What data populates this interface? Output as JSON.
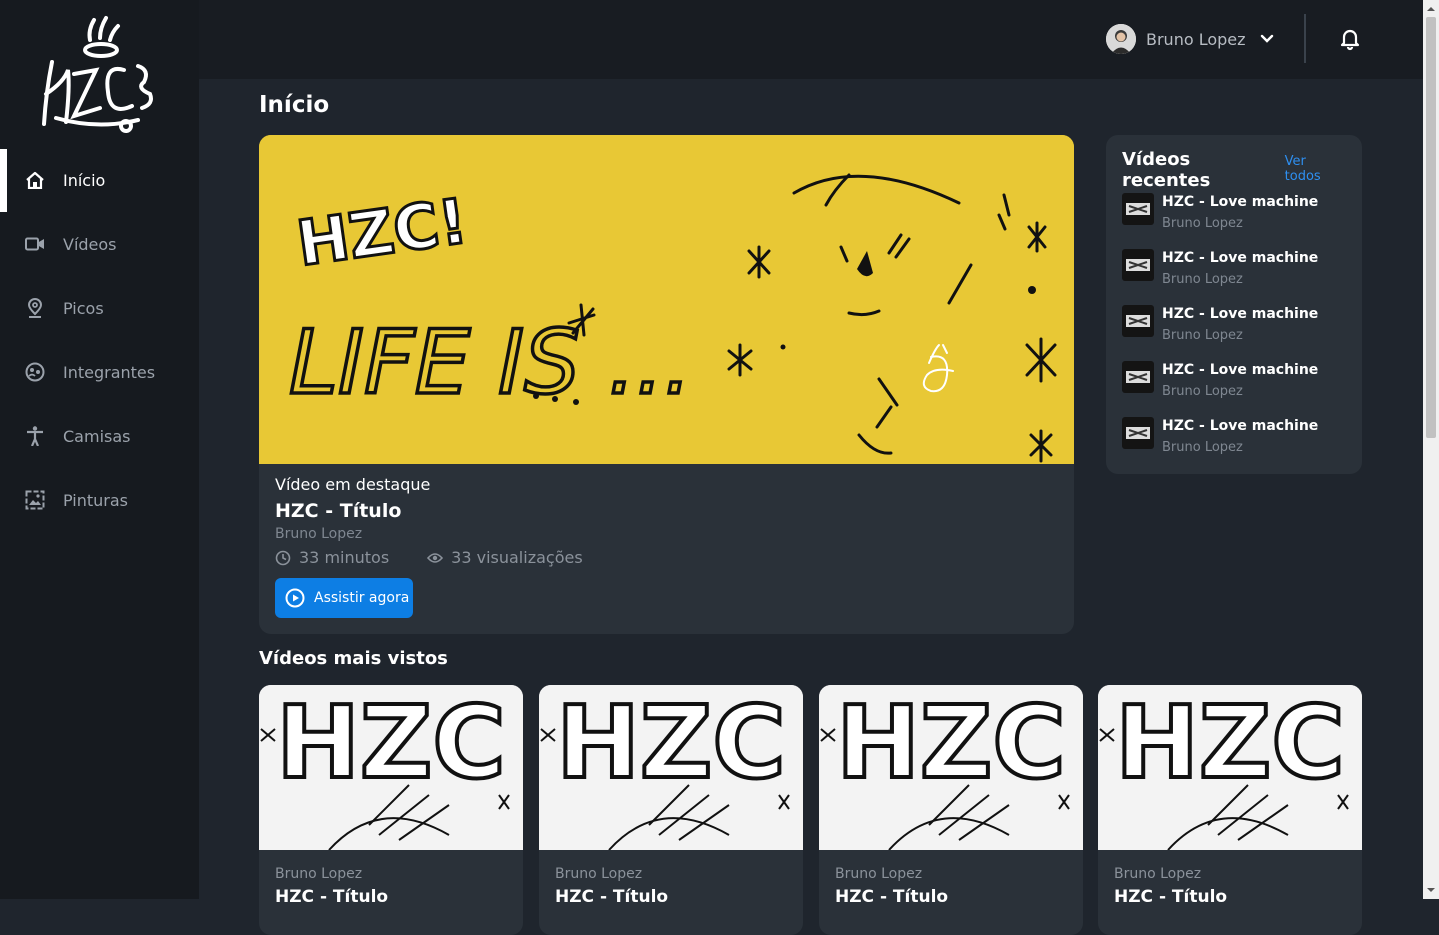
{
  "sidebar": {
    "items": [
      {
        "label": "Início",
        "icon": "home-icon"
      },
      {
        "label": "Vídeos",
        "icon": "video-camera-icon"
      },
      {
        "label": "Picos",
        "icon": "map-pin-icon"
      },
      {
        "label": "Integrantes",
        "icon": "group-icon"
      },
      {
        "label": "Camisas",
        "icon": "person-icon"
      },
      {
        "label": "Pinturas",
        "icon": "painting-icon"
      }
    ]
  },
  "header": {
    "user_name": "Bruno Lopez"
  },
  "page": {
    "title": "Início"
  },
  "featured": {
    "label": "Vídeo em destaque",
    "title": "HZC - Título",
    "author": "Bruno Lopez",
    "duration": "33 minutos",
    "views": "33 visualizações",
    "button": "Assistir agora",
    "art_text_top": "HZC!",
    "art_text_main": "LIFE IS ..."
  },
  "recent": {
    "title": "Vídeos recentes",
    "see_all": "Ver todos",
    "items": [
      {
        "title": "HZC - Love machine",
        "author": "Bruno Lopez"
      },
      {
        "title": "HZC - Love machine",
        "author": "Bruno Lopez"
      },
      {
        "title": "HZC - Love machine",
        "author": "Bruno Lopez"
      },
      {
        "title": "HZC - Love machine",
        "author": "Bruno Lopez"
      },
      {
        "title": "HZC - Love machine",
        "author": "Bruno Lopez"
      }
    ]
  },
  "most_viewed": {
    "title": "Vídeos mais vistos",
    "thumb_text": "HZC",
    "cards": [
      {
        "author": "Bruno Lopez",
        "title": "HZC - Título"
      },
      {
        "author": "Bruno Lopez",
        "title": "HZC - Título"
      },
      {
        "author": "Bruno Lopez",
        "title": "HZC - Título"
      },
      {
        "author": "Bruno Lopez",
        "title": "HZC - Título"
      }
    ]
  },
  "colors": {
    "accent": "#0d7ee4",
    "featured_bg": "#e8c835",
    "link": "#2e8ff0"
  }
}
